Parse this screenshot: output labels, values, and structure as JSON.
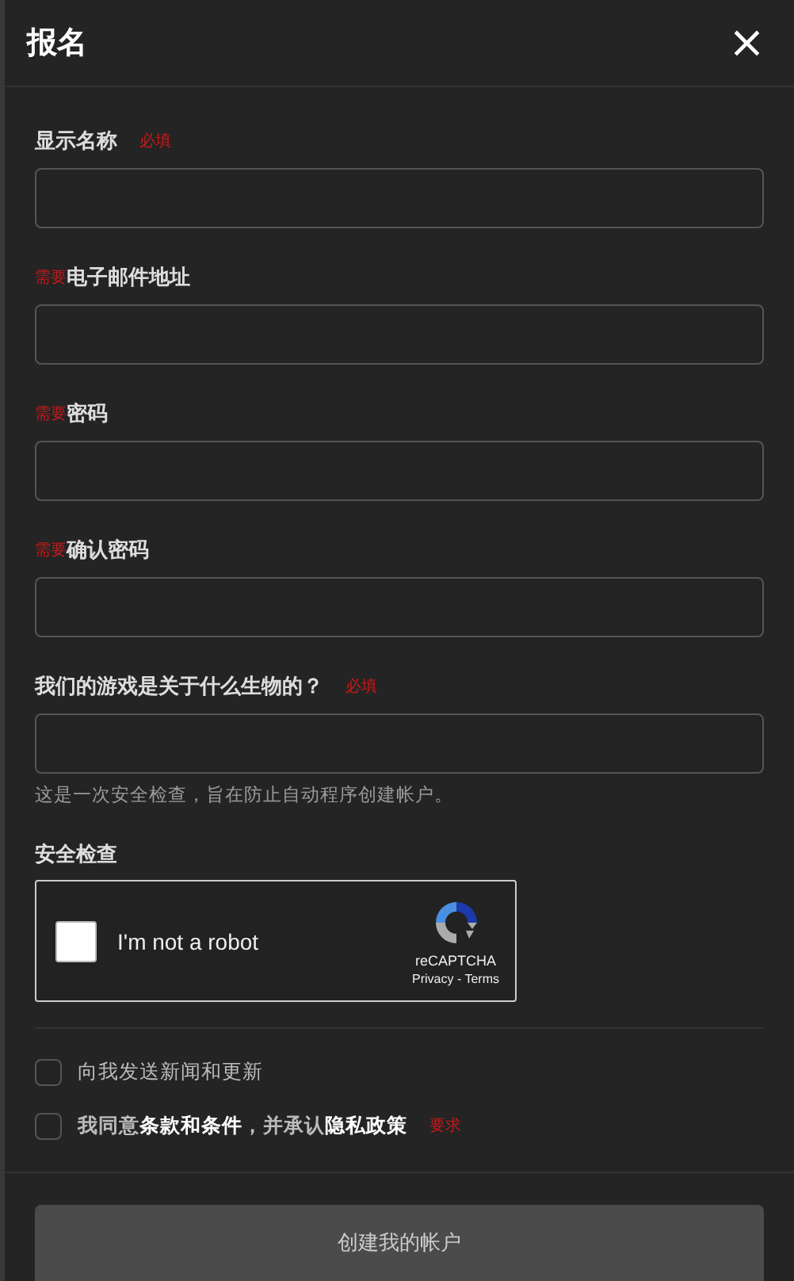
{
  "dialog": {
    "title": "报名",
    "close": "×"
  },
  "fields": [
    {
      "label": "显示名称",
      "tag": "必填",
      "kind": "suffixed"
    },
    {
      "label": "电子邮件地址",
      "tag": "需要",
      "kind": "prefixed"
    },
    {
      "label": "密码",
      "tag": "需要",
      "kind": "prefixed"
    },
    {
      "label": "确认密码",
      "tag": "需要",
      "kind": "prefixed"
    },
    {
      "label": "我们的游戏是关于什么生物的？",
      "tag": "必填",
      "kind": "suffixed",
      "hint": "这是一次安全检查，旨在防止自动程序创建帐户。"
    }
  ],
  "security": {
    "label": "安全检查",
    "captcha": {
      "text": "I'm not a robot",
      "checked": false,
      "brand": "reCAPTCHA",
      "links": "Privacy - Terms"
    }
  },
  "options": [
    {
      "text": "向我发送新闻和更新",
      "checked": false
    },
    {
      "text": "我同意**条款和条件**，并承认**隐私政策**",
      "checked": false,
      "tag": "要求"
    }
  ],
  "submit": "创建我的帐户"
}
